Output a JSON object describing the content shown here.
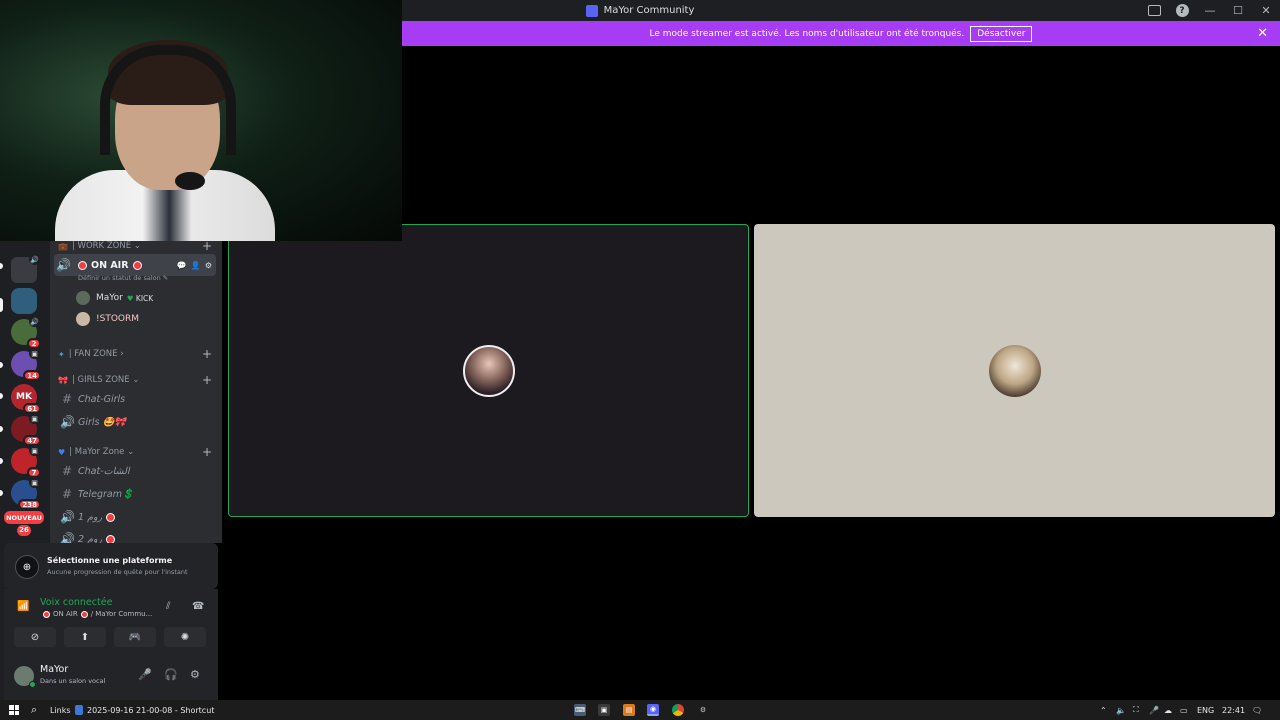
{
  "titlebar": {
    "title": "MaYor Community",
    "help": "?"
  },
  "banner": {
    "message": "Le mode streamer est activé. Les noms d'utilisateur ont été tronqués.",
    "button_label": "Désactiver",
    "close": "✕"
  },
  "servers": {
    "badges": [
      "2",
      "14",
      "61",
      "47",
      "7",
      "238",
      "26"
    ],
    "initials": [
      "MK"
    ],
    "new_label": "NOUVEAU"
  },
  "channels": {
    "work_zone": "WORK ZONE",
    "on_air": "ON AIR",
    "status_hint": "Définir un statut de salon ✎",
    "voice_users": [
      {
        "name": "MaYor",
        "tag": "KICK"
      },
      {
        "name": "!STOORM"
      }
    ],
    "fan_zone": "FAN ZONE",
    "girls_zone": "GIRLS ZONE",
    "chat_girls": "Chat-Girls",
    "girls_voice": "Girls 🤩🎀",
    "mayor_zone": "MaYor Zone",
    "chat_arabic": "Chat-الشات",
    "telegram": "Telegram💲",
    "voice1": "1 روم",
    "voice2": "2 روم"
  },
  "quest": {
    "title": "Sélectionne une plateforme",
    "subtitle": "Aucune progression de quête pour l'instant"
  },
  "voice_panel": {
    "title": "Voix connectée",
    "channel": "ON AIR",
    "server": "/ MaYor Commu..."
  },
  "user": {
    "name": "MaYor",
    "status": "Dans un salon vocal"
  },
  "taskbar": {
    "links": "Links",
    "file": "2025-09-16 21-00-08 - Shortcut",
    "lang": "ENG",
    "time": "22:41"
  }
}
